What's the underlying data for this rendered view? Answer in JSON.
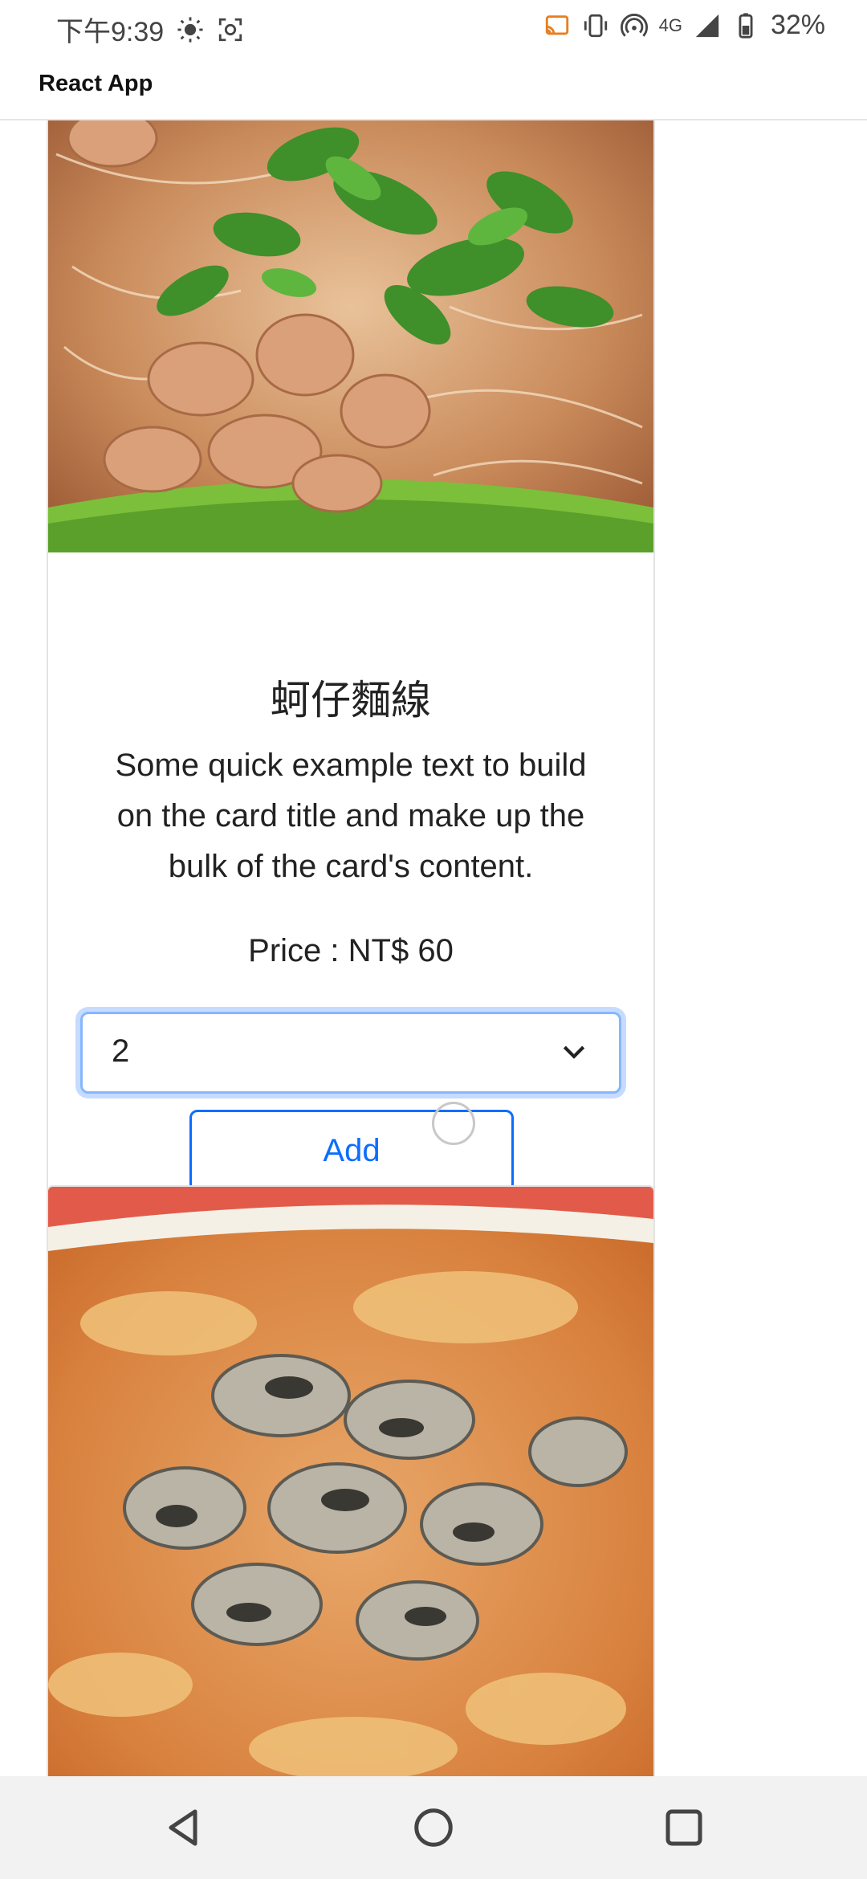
{
  "status_bar": {
    "time": "下午9:39",
    "network": "4G",
    "battery": "32%",
    "icons": [
      "brightness-icon",
      "screenshot-icon",
      "cast-icon",
      "vibrate-icon",
      "hotspot-icon",
      "signal-icon",
      "battery-icon"
    ]
  },
  "app_bar": {
    "title": "React App"
  },
  "cards": [
    {
      "title": "蚵仔麵線",
      "text": "Some quick example text to build on the card title and make up the bulk of the card's content.",
      "price": "Price : NT$ 60",
      "quantity": "2",
      "add_label": "Add"
    }
  ],
  "navigation": {
    "icons": [
      "back-icon",
      "home-icon",
      "recents-icon"
    ]
  },
  "colors": {
    "accent": "#0d6efd",
    "focus_ring": "#86b7fe",
    "nav_bar": "#f2f2f2"
  }
}
